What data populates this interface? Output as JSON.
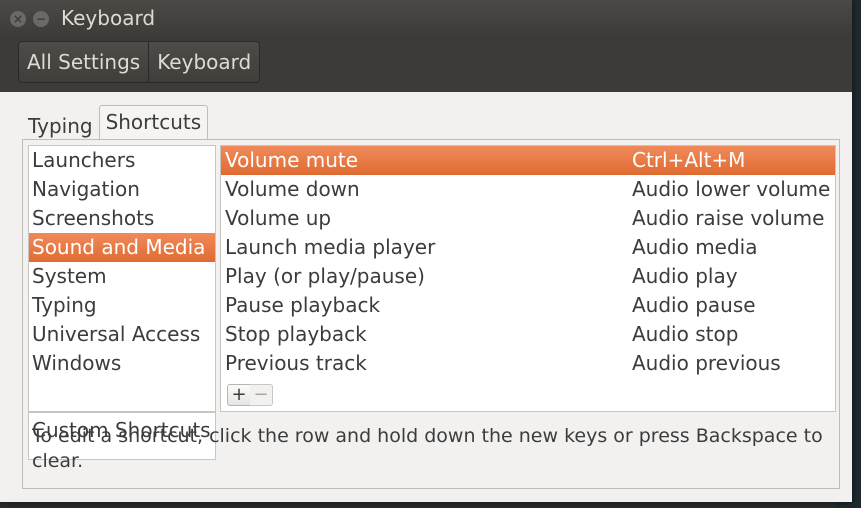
{
  "window": {
    "title": "Keyboard"
  },
  "toolbar": {
    "breadcrumbs": [
      "All Settings",
      "Keyboard"
    ]
  },
  "tabs": [
    {
      "label": "Typing",
      "active": false
    },
    {
      "label": "Shortcuts",
      "active": true
    }
  ],
  "categories": [
    {
      "label": "Launchers"
    },
    {
      "label": "Navigation"
    },
    {
      "label": "Screenshots"
    },
    {
      "label": "Sound and Media",
      "selected": true
    },
    {
      "label": "System"
    },
    {
      "label": "Typing"
    },
    {
      "label": "Universal Access"
    },
    {
      "label": "Windows"
    }
  ],
  "custom_shortcuts_label": "Custom Shortcuts",
  "shortcuts": [
    {
      "action": "Volume mute",
      "accel": "Ctrl+Alt+M",
      "selected": true
    },
    {
      "action": "Volume down",
      "accel": "Audio lower volume"
    },
    {
      "action": "Volume up",
      "accel": "Audio raise volume"
    },
    {
      "action": "Launch media player",
      "accel": "Audio media"
    },
    {
      "action": "Play (or play/pause)",
      "accel": "Audio play"
    },
    {
      "action": "Pause playback",
      "accel": "Audio pause"
    },
    {
      "action": "Stop playback",
      "accel": "Audio stop"
    },
    {
      "action": "Previous track",
      "accel": "Audio previous"
    }
  ],
  "list_toolbar": {
    "add_label": "+",
    "remove_label": "−"
  },
  "hint": "To edit a shortcut, click the row and hold down the new keys or press Backspace to clear.",
  "icons": {
    "close": "close-icon",
    "minimize": "minimize-icon"
  },
  "colors": {
    "selection": "#e8733e",
    "titlebar": "#3c3b37"
  }
}
